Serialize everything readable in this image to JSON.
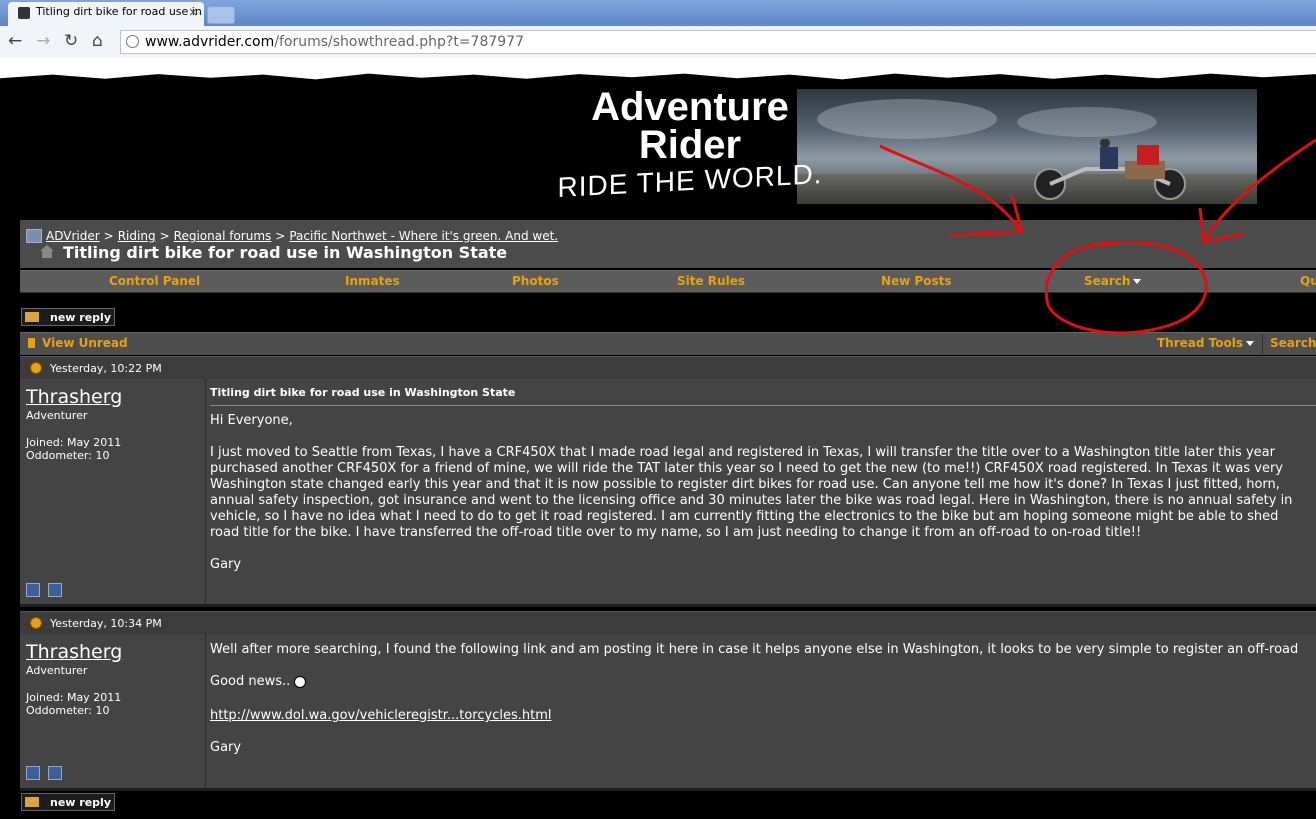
{
  "browser": {
    "tab_title": "Titling dirt bike for road use in",
    "tab_close": "×",
    "url_domain": "www.advrider.com",
    "url_path": "/forums/showthread.php?t=787977"
  },
  "banner": {
    "line1": "Adventure",
    "line2": "Rider",
    "line3": "RIDE THE WORLD."
  },
  "breadcrumb": {
    "items": [
      "ADVrider",
      "Riding",
      "Regional forums",
      "Pacific Northwet - Where it's green. And wet."
    ],
    "separator": ">"
  },
  "thread": {
    "title": "Titling dirt bike for road use in Washington State"
  },
  "menu": {
    "items": [
      "Control Panel",
      "Inmates",
      "Photos",
      "Site Rules",
      "New Posts",
      "Search",
      "Qu"
    ]
  },
  "buttons": {
    "new_reply": "new reply"
  },
  "toolbar": {
    "view_unread": "View Unread",
    "thread_tools": "Thread Tools",
    "search": "Search"
  },
  "posts": [
    {
      "date": "Yesterday, 10:22 PM",
      "username": "Thrasherg",
      "user_title": "Adventurer",
      "joined": "Joined: May 2011",
      "odometer": "Oddometer: 10",
      "title": "Titling dirt bike for road use in Washington State",
      "greeting": "Hi Everyone,",
      "body_lines": [
        "I just moved to Seattle from Texas, I have a CRF450X that I made road legal and registered in Texas, I will transfer the title over to a Washington title later this year",
        "purchased another CRF450X for a friend of mine, we will ride the TAT later this year so I need to get the new (to me!!) CRF450X road registered. In Texas it was very",
        "Washington state changed early this year and that it is now possible to register dirt bikes for road use. Can anyone tell me how it's done? In Texas I just fitted, horn,",
        "annual safety inspection, got insurance and went to the licensing office and 30 minutes later the bike was road legal. Here in Washington, there is no annual safety in",
        "vehicle, so I have no idea what I need to do to get it road registered. I am currently fitting the electronics to the bike but am hoping someone might be able to shed",
        "road title for the bike. I have transferred the off-road title over to my name, so I am just needing to change it from an off-road to on-road title!!"
      ],
      "signoff": "Gary"
    },
    {
      "date": "Yesterday, 10:34 PM",
      "username": "Thrasherg",
      "user_title": "Adventurer",
      "joined": "Joined: May 2011",
      "odometer": "Oddometer: 10",
      "line1": "Well after more searching, I found the following link and am posting it here in case it helps anyone else in Washington, it looks to be very simple to register an off-road",
      "line2": "Good news..",
      "link": "http://www.dol.wa.gov/vehicleregistr...torcycles.html",
      "signoff": "Gary"
    }
  ],
  "colors": {
    "accent": "#e8a10f",
    "annotation": "#e01010",
    "panel": "#444444"
  }
}
